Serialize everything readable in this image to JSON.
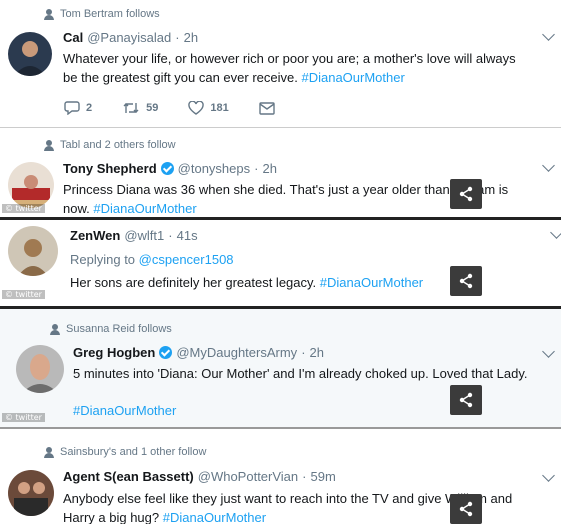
{
  "colors": {
    "link": "#1da1f2",
    "text": "#14171a",
    "muted": "#657786",
    "share_bg": "#3b3b3b",
    "highlight": "#f5f8fa"
  },
  "tweets": [
    {
      "context": "Tom Bertram follows",
      "name": "Cal",
      "handle": "@Panayisalad",
      "time": "2h",
      "line1": "Whatever your life, or however rich or poor you are; a mother's love will always",
      "line2_prefix": "be the greatest gift you can ever receive.",
      "hashtag": "#DianaOurMother",
      "replies": "2",
      "retweets": "59",
      "likes": "181",
      "icons": {
        "reply": "reply-icon",
        "retweet": "retweet-icon",
        "like": "heart-icon",
        "dm": "envelope-icon"
      }
    },
    {
      "context": "Tabl and 2 others follow",
      "name": "Tony Shepherd",
      "handle": "@tonysheps",
      "time": "2h",
      "line1": "Princess Diana was 36 when she died. That's just a year older than William is",
      "line2_prefix": "now.",
      "hashtag": "#DianaOurMother",
      "watermark": "twitter"
    },
    {
      "name": "ZenWen",
      "handle": "@wlft1",
      "time": "41s",
      "replying_prefix": "Replying to",
      "replying_handle": "@cspencer1508",
      "line1_prefix": "Her sons are definitely her greatest legacy.",
      "hashtag": "#DianaOurMother",
      "watermark": "twitter"
    },
    {
      "context": "Susanna Reid follows",
      "name": "Greg Hogben",
      "handle": "@MyDaughtersArmy",
      "time": "2h",
      "line1": "5 minutes into 'Diana: Our Mother' and I'm already choked up. Loved that Lady.",
      "hashtag": "#DianaOurMother",
      "watermark": "twitter"
    },
    {
      "context": "Sainsbury's and 1 other follow",
      "name": "Agent S(ean Bassett)",
      "handle": "@WhoPotterVian",
      "time": "59m",
      "line1": "Anybody else feel like they just want to reach into the TV and give William and",
      "line2_prefix": "Harry a big hug?",
      "hashtag": "#DianaOurMother"
    }
  ],
  "separator": "·"
}
